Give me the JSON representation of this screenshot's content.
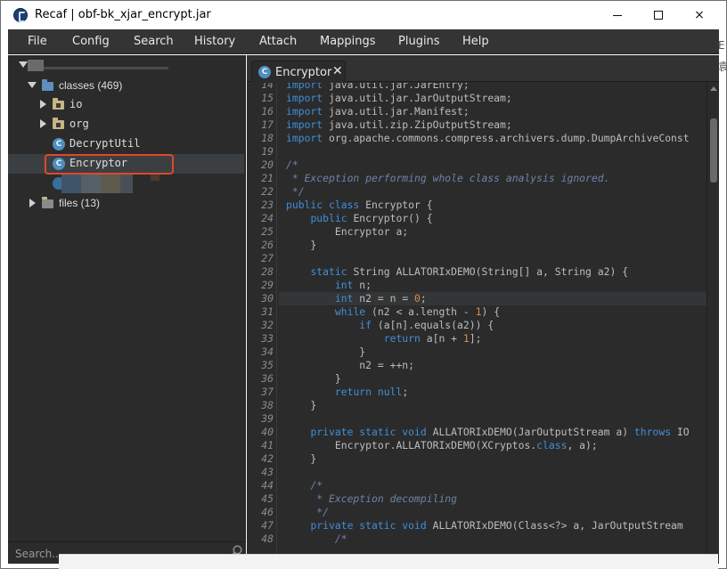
{
  "window": {
    "title": "Recaf | obf-bk_xjar_encrypt.jar",
    "controls": {
      "minimize": "minimize",
      "maximize": "maximize",
      "close": "×"
    }
  },
  "menu": [
    "File",
    "Config",
    "Search",
    "History",
    "Attach",
    "Mappings",
    "Plugins",
    "Help"
  ],
  "background_fragments": {
    "right_edge_top": "E",
    "right_edge_mid": "袁"
  },
  "tree": {
    "classes": {
      "label": "classes (469)"
    },
    "packages": [
      {
        "label": "io"
      },
      {
        "label": "org"
      }
    ],
    "class_items": [
      {
        "icon": "C",
        "label": "DecryptUtil"
      },
      {
        "icon": "C",
        "label": "Encryptor"
      }
    ],
    "files": {
      "label": "files (13)"
    }
  },
  "search": {
    "placeholder": "Search..."
  },
  "editor": {
    "tab": {
      "icon": "C",
      "label": "Encryptor",
      "close": "✕"
    },
    "lines": [
      {
        "n": 14,
        "html": "<span class=\"kw\">import</span> java.util.jar.JarEntry;"
      },
      {
        "n": 15,
        "html": "<span class=\"kw\">import</span> java.util.jar.JarOutputStream;"
      },
      {
        "n": 16,
        "html": "<span class=\"kw\">import</span> java.util.jar.Manifest;"
      },
      {
        "n": 17,
        "html": "<span class=\"kw\">import</span> java.util.zip.ZipOutputStream;"
      },
      {
        "n": 18,
        "html": "<span class=\"kw\">import</span> org.apache.commons.compress.archivers.dump.DumpArchiveConst"
      },
      {
        "n": 19,
        "html": ""
      },
      {
        "n": 20,
        "html": "<span class=\"cm\">/*</span>"
      },
      {
        "n": 21,
        "html": "<span class=\"cm\"> * Exception performing whole class analysis ignored.</span>"
      },
      {
        "n": 22,
        "html": "<span class=\"cm\"> */</span>"
      },
      {
        "n": 23,
        "html": "<span class=\"kw\">public class</span> Encryptor {"
      },
      {
        "n": 24,
        "html": "    <span class=\"kw\">public</span> Encryptor() {"
      },
      {
        "n": 25,
        "html": "        Encryptor a;"
      },
      {
        "n": 26,
        "html": "    }"
      },
      {
        "n": 27,
        "html": ""
      },
      {
        "n": 28,
        "html": "    <span class=\"kw\">static</span> String ALLATORIxDEMO(String[] a, String a2) {"
      },
      {
        "n": 29,
        "html": "        <span class=\"kw\">int</span> n;"
      },
      {
        "n": 30,
        "html": "        <span class=\"kw\">int</span> n2 = n = <span class=\"nm\">0</span>;",
        "current": true
      },
      {
        "n": 31,
        "html": "        <span class=\"kw\">while</span> (n2 &lt; a.length - <span class=\"nm\">1</span>) {"
      },
      {
        "n": 32,
        "html": "            <span class=\"kw\">if</span> (a[n].equals(a2)) {"
      },
      {
        "n": 33,
        "html": "                <span class=\"kw\">return</span> a[n + <span class=\"nm\">1</span>];"
      },
      {
        "n": 34,
        "html": "            }"
      },
      {
        "n": 35,
        "html": "            n2 = ++n;"
      },
      {
        "n": 36,
        "html": "        }"
      },
      {
        "n": 37,
        "html": "        <span class=\"kw\">return null</span>;"
      },
      {
        "n": 38,
        "html": "    }"
      },
      {
        "n": 39,
        "html": ""
      },
      {
        "n": 40,
        "html": "    <span class=\"kw\">private static void</span> ALLATORIxDEMO(JarOutputStream a) <span class=\"kw\">throws</span> IO"
      },
      {
        "n": 41,
        "html": "        Encryptor.ALLATORIxDEMO(XCryptos.<span class=\"kw\">class</span>, a);"
      },
      {
        "n": 42,
        "html": "    }"
      },
      {
        "n": 43,
        "html": ""
      },
      {
        "n": 44,
        "html": "    <span class=\"cm\">/*</span>"
      },
      {
        "n": 45,
        "html": "<span class=\"cm\">     * Exception decompiling</span>"
      },
      {
        "n": 46,
        "html": "<span class=\"cm\">     */</span>"
      },
      {
        "n": 47,
        "html": "    <span class=\"kw\">private static void</span> ALLATORIxDEMO(Class&lt;?&gt; a, JarOutputStream"
      },
      {
        "n": 48,
        "html": "        <span class=\"cm\">/*</span>"
      }
    ]
  },
  "colors": {
    "accent_keyword": "#3f8fd8",
    "comment": "#6e83a6",
    "number": "#d98c4a",
    "highlight_box": "#e0472c",
    "panel_bg": "#2b2b2b"
  }
}
